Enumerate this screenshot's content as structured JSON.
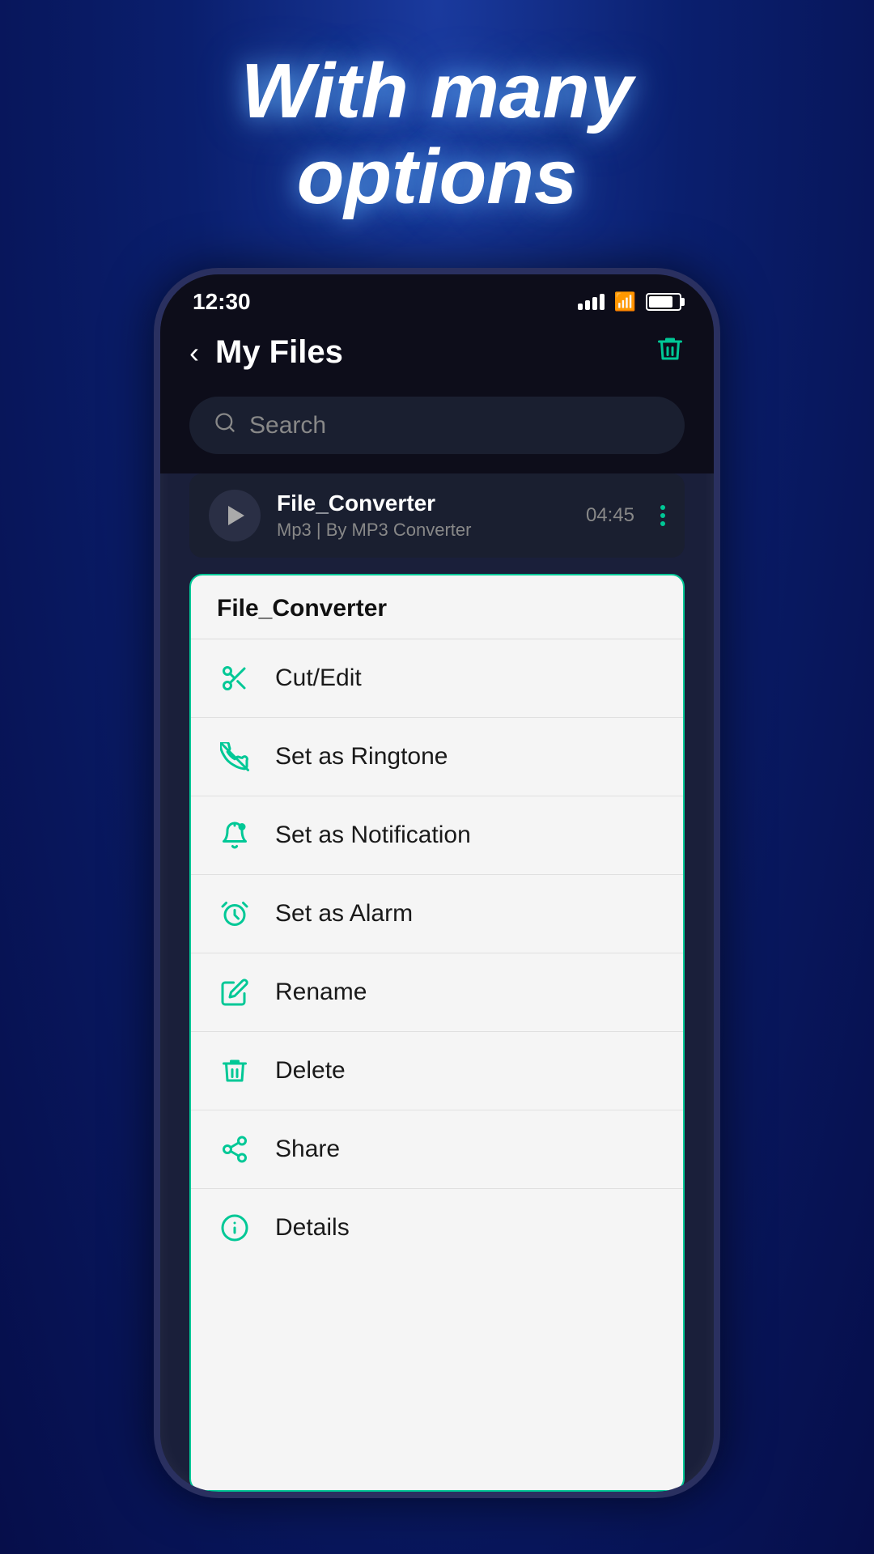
{
  "headline": {
    "line1": "With many",
    "line2": "options"
  },
  "status_bar": {
    "time": "12:30",
    "signal_bars": 4,
    "battery_percent": 80
  },
  "header": {
    "title": "My Files",
    "back_label": "‹",
    "trash_label": "🗑"
  },
  "search": {
    "placeholder": "Search"
  },
  "file": {
    "name": "File_Converter",
    "meta": "Mp3 | By MP3 Converter",
    "duration": "04:45"
  },
  "context_menu": {
    "title": "File_Converter",
    "items": [
      {
        "id": "cut-edit",
        "label": "Cut/Edit",
        "icon": "scissors"
      },
      {
        "id": "set-ringtone",
        "label": "Set as Ringtone",
        "icon": "ringtone"
      },
      {
        "id": "set-notification",
        "label": "Set as Notification",
        "icon": "bell"
      },
      {
        "id": "set-alarm",
        "label": "Set as Alarm",
        "icon": "alarm"
      },
      {
        "id": "rename",
        "label": "Rename",
        "icon": "pencil"
      },
      {
        "id": "delete",
        "label": "Delete",
        "icon": "trash"
      },
      {
        "id": "share",
        "label": "Share",
        "icon": "share"
      },
      {
        "id": "details",
        "label": "Details",
        "icon": "info"
      }
    ]
  },
  "colors": {
    "accent": "#00c896",
    "bg_dark": "#0d0d1a",
    "text_light": "#ffffff",
    "text_dark": "#1a1a1a"
  }
}
